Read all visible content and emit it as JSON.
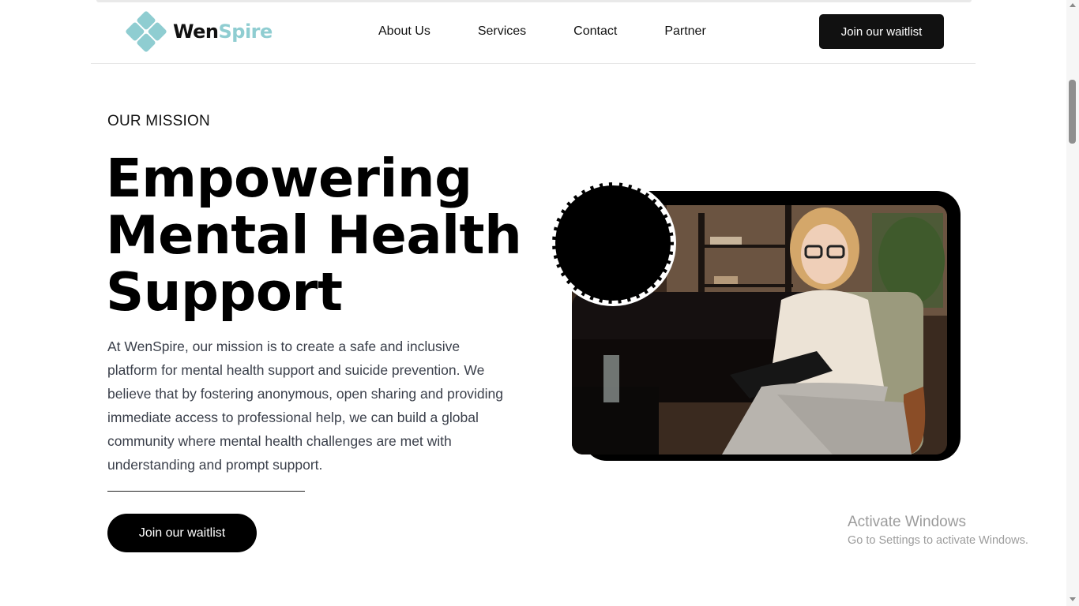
{
  "brand": {
    "name_part1": "Wen",
    "name_part2": "Spire",
    "logo_icon": "diamond-tiles-logo",
    "accent_color": "#8fcdd1"
  },
  "nav": {
    "items": [
      {
        "label": "About Us"
      },
      {
        "label": "Services"
      },
      {
        "label": "Contact"
      },
      {
        "label": "Partner"
      }
    ],
    "cta_label": "Join our waitlist"
  },
  "hero": {
    "eyebrow": "OUR MISSION",
    "headline_lines": [
      "Empowering",
      "Mental Health",
      "Support"
    ],
    "body": "At WenSpire, our mission is to create a safe and inclusive platform for mental health support and suicide prevention. We believe that by fostering anonymous, open sharing and providing immediate access to professional help, we can build a global community where mental health challenges are met with understanding and prompt support.",
    "cta_label": "Join our waitlist"
  },
  "image": {
    "subject": "therapist-photo"
  },
  "os_watermark": {
    "title": "Activate Windows",
    "subtitle": "Go to Settings to activate Windows."
  }
}
